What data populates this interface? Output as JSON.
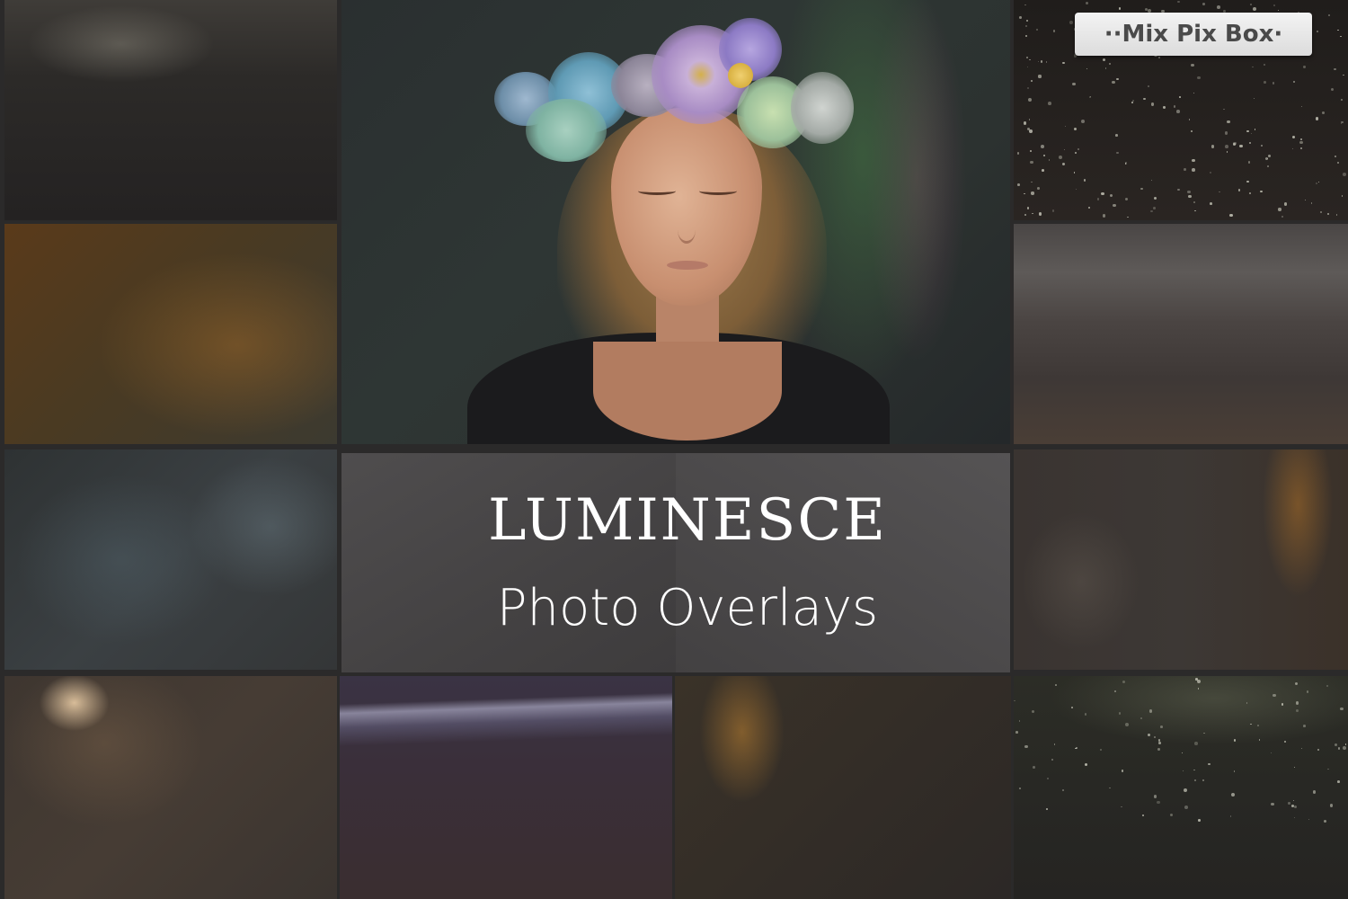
{
  "title": {
    "main": "LUMINESCE",
    "sub": "Photo Overlays"
  },
  "brand": {
    "label": "··Mix Pix Box·"
  },
  "main_photo": {
    "subject": "girl with closed eyes wearing a flower crown"
  },
  "overlay_tiles": [
    {
      "name": "dark-top-blur"
    },
    {
      "name": "gold-dust-sparkle"
    },
    {
      "name": "amber-glow"
    },
    {
      "name": "gray-light-streak"
    },
    {
      "name": "blue-gray-haze"
    },
    {
      "name": "orange-flare-edge"
    },
    {
      "name": "warm-bokeh"
    },
    {
      "name": "blue-light-streak"
    },
    {
      "name": "golden-flare"
    },
    {
      "name": "dark-sparkle-bokeh"
    }
  ],
  "colors": {
    "background": "#2b2a2a",
    "title_panel": "#4a4849",
    "title_text": "#ffffff",
    "badge_bg": "#e6e6e6",
    "badge_text": "#4a4a4a"
  }
}
